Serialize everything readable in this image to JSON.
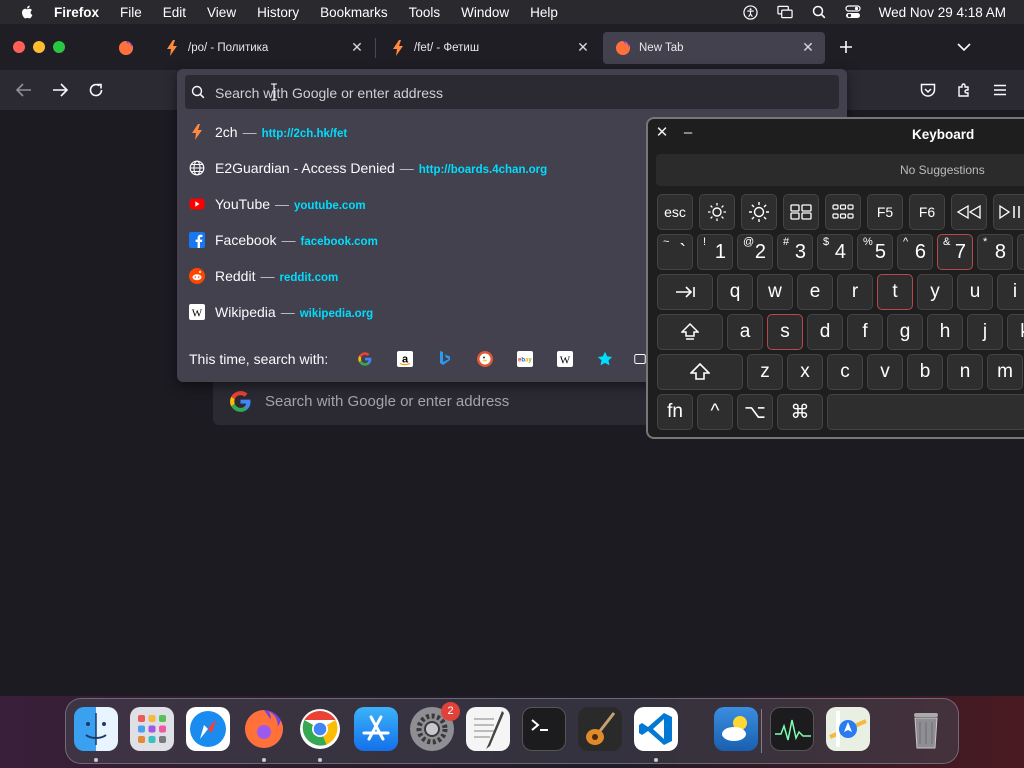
{
  "menubar": {
    "app_name": "Firefox",
    "items": [
      "File",
      "Edit",
      "View",
      "History",
      "Bookmarks",
      "Tools",
      "Window",
      "Help"
    ],
    "clock": "Wed Nov 29  4:18 AM"
  },
  "tabs": [
    {
      "title": "/po/ - Политика",
      "icon": "bolt-icon"
    },
    {
      "title": "/fet/ - Фетиш",
      "icon": "bolt-icon"
    },
    {
      "title": "New Tab",
      "icon": "firefox-icon"
    }
  ],
  "urlbar": {
    "placeholder": "Search with Google or enter address"
  },
  "suggestions": [
    {
      "title": "2ch",
      "url": "http://2ch.hk/fet",
      "icon": "bolt-icon"
    },
    {
      "title": "E2Guardian - Access Denied",
      "url": "http://boards.4chan.org",
      "icon": "globe-icon"
    },
    {
      "title": "YouTube",
      "url": "youtube.com",
      "icon": "youtube-icon"
    },
    {
      "title": "Facebook",
      "url": "facebook.com",
      "icon": "facebook-icon"
    },
    {
      "title": "Reddit",
      "url": "reddit.com",
      "icon": "reddit-icon"
    },
    {
      "title": "Wikipedia",
      "url": "wikipedia.org",
      "icon": "wikipedia-icon"
    }
  ],
  "search_with": {
    "label": "This time, search with:",
    "engines": [
      "google-icon",
      "amazon-icon",
      "bing-icon",
      "duckduckgo-icon",
      "ebay-icon",
      "wikipedia-icon",
      "bookmarks-star-icon",
      "tabs-icon"
    ]
  },
  "newtab": {
    "search_placeholder": "Search with Google or enter address"
  },
  "keyboard": {
    "title": "Keyboard",
    "suggestions_text": "No Suggestions",
    "fn_row": [
      "esc",
      "brightness-down-icon",
      "brightness-up-icon",
      "mission-control-icon",
      "launchpad-icon",
      "F5",
      "F6",
      "rewind-icon",
      "play-pause-icon"
    ],
    "number_row": [
      {
        "shift": "~",
        "main": "`"
      },
      {
        "shift": "!",
        "main": "1"
      },
      {
        "shift": "@",
        "main": "2"
      },
      {
        "shift": "#",
        "main": "3"
      },
      {
        "shift": "$",
        "main": "4"
      },
      {
        "shift": "%",
        "main": "5"
      },
      {
        "shift": "^",
        "main": "6"
      },
      {
        "shift": "&",
        "main": "7"
      },
      {
        "shift": "*",
        "main": "8"
      }
    ],
    "qwerty_row": [
      "q",
      "w",
      "e",
      "r",
      "t",
      "y",
      "u",
      "i"
    ],
    "home_row": [
      "a",
      "s",
      "d",
      "f",
      "g",
      "h",
      "j",
      "k"
    ],
    "bottom_row": [
      "z",
      "x",
      "c",
      "v",
      "b",
      "n",
      "m"
    ],
    "fn_key": "fn",
    "control_symbol": "^",
    "option_symbol": "⌥",
    "command_symbol": "⌘"
  },
  "dock": {
    "apps": [
      "Finder",
      "Launchpad",
      "Safari",
      "Firefox",
      "Google Chrome",
      "App Store",
      "System Settings",
      "TextEdit",
      "Terminal",
      "GarageBand",
      "Visual Studio Code",
      "Weather",
      "Activity Monitor",
      "Maps",
      "Trash"
    ],
    "system_settings_badge": "2"
  }
}
